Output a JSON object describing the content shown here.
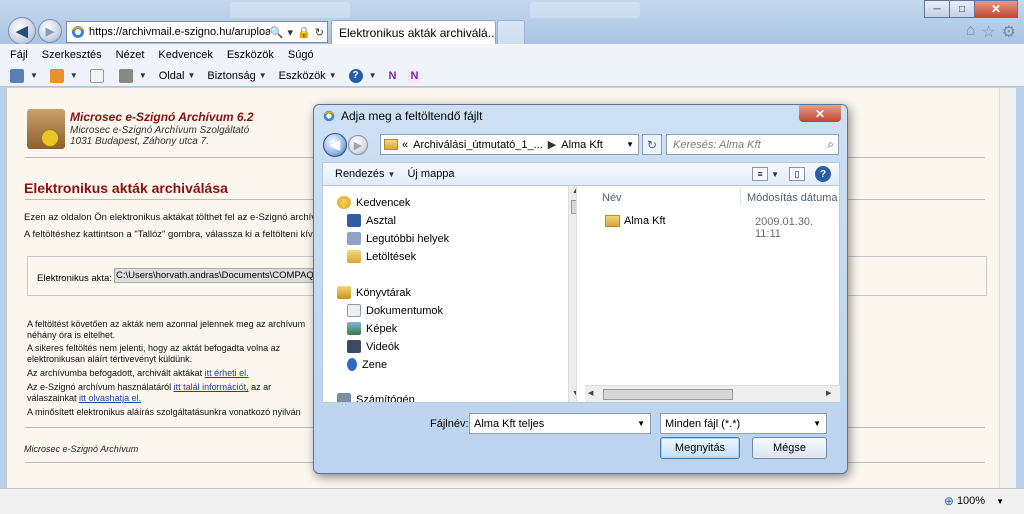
{
  "browser": {
    "address_url": "https://archivmail.e-szigno.hu/arupload",
    "active_tab_title": "Elektronikus akták archiválá...",
    "tab_close": "×",
    "back_glyph": "◀",
    "forward_glyph": "▶",
    "addr_icons": [
      "🔍",
      "▾",
      "🔒",
      "↻"
    ],
    "right_icons": [
      "⌂",
      "☆",
      "⚙"
    ]
  },
  "window_controls": {
    "minimize": "─",
    "maximize": "□",
    "close": "✕"
  },
  "menu": [
    "Fájl",
    "Szerkesztés",
    "Nézet",
    "Kedvencek",
    "Eszközök",
    "Súgó"
  ],
  "commandbar": {
    "page": "Oldal",
    "safety": "Biztonság",
    "tools": "Eszközök",
    "help_glyph": "?",
    "n1": "N",
    "n2": "N",
    "dropdown": "▼"
  },
  "page": {
    "brand_title": "Microsec e-Szignó Archívum 6.2",
    "brand_sub1": "Microsec e-Szignó Archívum Szolgáltató",
    "brand_sub2": "1031 Budapest, Záhony utca 7.",
    "heading": "Elektronikus akták archiválása",
    "intro1": "Ezen az oldalon Ön elektronikus aktákat tölthet fel az e-Szignó archív",
    "intro2": "A feltöltéshez kattintson a \"Tallóz\" gombra, válassza ki a feltölteni kív",
    "upload_label": "Elektronikus akta:",
    "upload_value": "C:\\Users\\horvath.andras\\Documents\\COMPAQ\\",
    "info": [
      "A feltöltést követően az akták nem azonnal jelennek meg az archívum",
      "néhány óra is eltelhet.",
      "A sikeres feltöltés nem jelenti, hogy az aktát befogadta volna az",
      "elektronikusan aláírt tértivevényt küldünk.",
      "Az archívumba befogadott, archivált aktákat",
      "itt érheti el.",
      "Az e-Szignó archívum használatáról",
      "itt talál információt,",
      "az ar",
      "válaszainkat",
      "itt olvashatja el.",
      "A minősített elektronikus aláírás szolgáltatásunkra vonatkozó nyilván"
    ],
    "footer": "Microsec e-Szignó Archívum"
  },
  "status": {
    "zoom": "100%",
    "zoom_arrow": "▼"
  },
  "dialog": {
    "title": "Adja meg a feltöltendő fájlt",
    "close": "✕",
    "path_prefix": "«",
    "path_part1": "Archiválási_útmutató_1_...",
    "path_sep": "▶",
    "path_part2": "Alma Kft",
    "refresh": "↻",
    "search_placeholder": "Keresés: Alma Kft",
    "search_icon": "⌕",
    "organize": "Rendezés",
    "new_folder": "Új mappa",
    "help": "?",
    "nav": {
      "favorites": "Kedvencek",
      "fav_items": [
        "Asztal",
        "Legutóbbi helyek",
        "Letöltések"
      ],
      "libraries": "Könyvtárak",
      "lib_items": [
        "Dokumentumok",
        "Képek",
        "Videók",
        "Zene"
      ],
      "computer": "Számítógép"
    },
    "columns": {
      "name": "Név",
      "modified": "Módosítás dátuma"
    },
    "files": [
      {
        "name": "Alma Kft",
        "date": "2009.01.30. 11:11"
      }
    ],
    "filename_label": "Fájlnév:",
    "filename_value": "Alma Kft teljes",
    "filetype_value": "Minden fájl (*.*)",
    "open_button": "Megnyitás",
    "cancel_button": "Mégse"
  }
}
